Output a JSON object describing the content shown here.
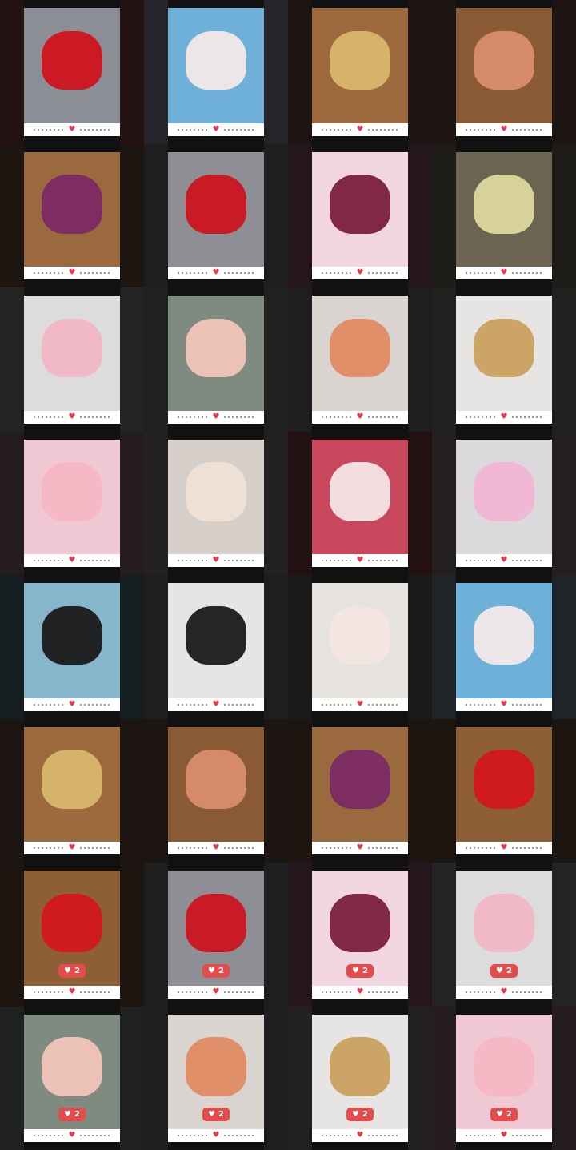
{
  "tiles": [
    {
      "bleed": "#3a1414",
      "card": "#8b8e95",
      "subject": "#d0141e",
      "likes": ""
    },
    {
      "bleed": "#3b3b4a",
      "card": "#6fb0d8",
      "subject": "#f2e9ea",
      "likes": ""
    },
    {
      "bleed": "#2a1b12",
      "card": "#9c6a3c",
      "subject": "#d8b76c",
      "likes": ""
    },
    {
      "bleed": "#2b1a12",
      "card": "#8a5a35",
      "subject": "#d98d6d",
      "likes": ""
    },
    {
      "bleed": "#2a1a10",
      "card": "#9a6a3e",
      "subject": "#7b2a63",
      "likes": ""
    },
    {
      "bleed": "#2e2e30",
      "card": "#8d8f94",
      "subject": "#cc1520",
      "likes": ""
    },
    {
      "bleed": "#3d1c2e",
      "card": "#f2d6e1",
      "subject": "#7a1f3b",
      "likes": ""
    },
    {
      "bleed": "#2c2b24",
      "card": "#6c6350",
      "subject": "#dcd89e",
      "likes": ""
    },
    {
      "bleed": "#3a3a3a",
      "card": "#dcdcdc",
      "subject": "#f1b6c5",
      "likes": ""
    },
    {
      "bleed": "#2f3530",
      "card": "#7f8a80",
      "subject": "#f2c4b8",
      "likes": ""
    },
    {
      "bleed": "#2f2f32",
      "card": "#d9d4cf",
      "subject": "#e28b63",
      "likes": ""
    },
    {
      "bleed": "#3a3533",
      "card": "#e7e5e3",
      "subject": "#caa05f",
      "likes": ""
    },
    {
      "bleed": "#3b2a30",
      "card": "#f0c8d4",
      "subject": "#f4b7c3",
      "likes": ""
    },
    {
      "bleed": "#3a3535",
      "card": "#d6cfc9",
      "subject": "#f0e0d6",
      "likes": ""
    },
    {
      "bleed": "#3a1010",
      "card": "#c9475c",
      "subject": "#f5e6e6",
      "likes": ""
    },
    {
      "bleed": "#3a3032",
      "card": "#dcd9dc",
      "subject": "#f1b6d4",
      "likes": ""
    },
    {
      "bleed": "#1d2c35",
      "card": "#86b6cc",
      "subject": "#1a1a1a",
      "likes": ""
    },
    {
      "bleed": "#2f2f30",
      "card": "#e5e5e6",
      "subject": "#1a1a1c",
      "likes": ""
    },
    {
      "bleed": "#262626",
      "card": "#e6e2dd",
      "subject": "#f3e6e2",
      "likes": ""
    },
    {
      "bleed": "#2e3b45",
      "card": "#6fb0d8",
      "subject": "#f2e9ea",
      "likes": ""
    },
    {
      "bleed": "#2b1b12",
      "card": "#9c6a3c",
      "subject": "#d8b76c",
      "likes": ""
    },
    {
      "bleed": "#2b1a12",
      "card": "#8a5a35",
      "subject": "#d98d6d",
      "likes": ""
    },
    {
      "bleed": "#2a1a10",
      "card": "#9a6a3e",
      "subject": "#7b2a63",
      "likes": ""
    },
    {
      "bleed": "#2a1a10",
      "card": "#8e5f36",
      "subject": "#d3171f",
      "likes": ""
    },
    {
      "bleed": "#2a1a10",
      "card": "#8e5f36",
      "subject": "#d3171f",
      "likes": "2"
    },
    {
      "bleed": "#2e2e30",
      "card": "#8d8f94",
      "subject": "#cc1520",
      "likes": "2"
    },
    {
      "bleed": "#3d1c2e",
      "card": "#f2d6e1",
      "subject": "#7a1f3b",
      "likes": "2"
    },
    {
      "bleed": "#3a3a3a",
      "card": "#dcdcdc",
      "subject": "#f1b6c5",
      "likes": "2"
    },
    {
      "bleed": "#2f3530",
      "card": "#7f8a80",
      "subject": "#f2c4b8",
      "likes": "2"
    },
    {
      "bleed": "#2f2f32",
      "card": "#d9d4cf",
      "subject": "#e28b63",
      "likes": "2"
    },
    {
      "bleed": "#3a3533",
      "card": "#e7e5e3",
      "subject": "#caa05f",
      "likes": "2"
    },
    {
      "bleed": "#3b2a30",
      "card": "#f0c8d4",
      "subject": "#f4b7c3",
      "likes": "2"
    }
  ]
}
